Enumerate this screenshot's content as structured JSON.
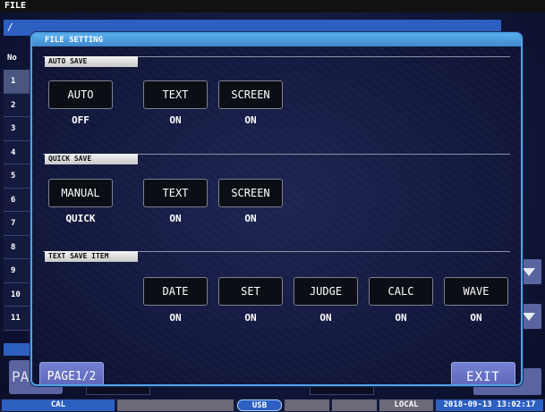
{
  "app": {
    "title": "FILE",
    "path": "/"
  },
  "background": {
    "header_no": "No",
    "rows": [
      "1",
      "2",
      "3",
      "4",
      "5",
      "6",
      "7",
      "8",
      "9",
      "10",
      "11"
    ],
    "page_button_label": "PA"
  },
  "dialog": {
    "title": "FILE SETTING",
    "auto_save": {
      "label": "AUTO SAVE",
      "auto": {
        "label": "AUTO",
        "value": "OFF"
      },
      "text": {
        "label": "TEXT",
        "value": "ON"
      },
      "screen": {
        "label": "SCREEN",
        "value": "ON"
      }
    },
    "quick_save": {
      "label": "QUICK SAVE",
      "manual": {
        "label": "MANUAL",
        "value": "QUICK"
      },
      "text": {
        "label": "TEXT",
        "value": "ON"
      },
      "screen": {
        "label": "SCREEN",
        "value": "ON"
      }
    },
    "text_save_item": {
      "label": "TEXT SAVE ITEM",
      "date": {
        "label": "DATE",
        "value": "ON"
      },
      "set": {
        "label": "SET",
        "value": "ON"
      },
      "judge": {
        "label": "JUDGE",
        "value": "ON"
      },
      "calc": {
        "label": "CALC",
        "value": "ON"
      },
      "wave": {
        "label": "WAVE",
        "value": "ON"
      }
    },
    "page_label": "PAGE1/2",
    "exit_label": "EXIT"
  },
  "status": {
    "cal": "CAL",
    "usb": "USB",
    "local": "LOCAL",
    "datetime": "2018-09-13 13:02:17"
  },
  "colors": {
    "accent_blue": "#2d5fc0",
    "dialog_border": "#4fa2e6",
    "button_bg": "#0b0e14",
    "nav_button": "#6470c4"
  }
}
